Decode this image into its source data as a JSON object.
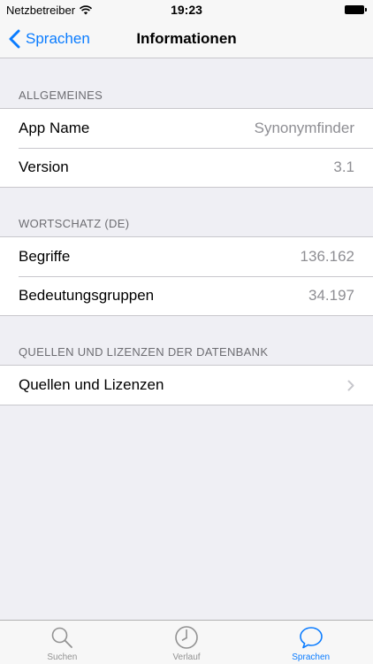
{
  "status_bar": {
    "carrier": "Netzbetreiber",
    "time": "19:23"
  },
  "nav": {
    "back_label": "Sprachen",
    "title": "Informationen"
  },
  "sections": [
    {
      "header": "ALLGEMEINES",
      "rows": [
        {
          "label": "App Name",
          "value": "Synonymfinder"
        },
        {
          "label": "Version",
          "value": "3.1"
        }
      ]
    },
    {
      "header": "WORTSCHATZ (DE)",
      "rows": [
        {
          "label": "Begriffe",
          "value": "136.162"
        },
        {
          "label": "Bedeutungsgruppen",
          "value": "34.197"
        }
      ]
    },
    {
      "header": "QUELLEN UND LIZENZEN DER DATENBANK",
      "rows": [
        {
          "label": "Quellen und Lizenzen",
          "value": ""
        }
      ]
    }
  ],
  "tabs": [
    {
      "label": "Suchen",
      "icon": "search-icon"
    },
    {
      "label": "Verlauf",
      "icon": "clock-icon"
    },
    {
      "label": "Sprachen",
      "icon": "speech-bubble-icon",
      "active": true
    }
  ],
  "colors": {
    "accent": "#0a7cff",
    "background": "#efeff4",
    "secondary_text": "#8e8e93"
  }
}
